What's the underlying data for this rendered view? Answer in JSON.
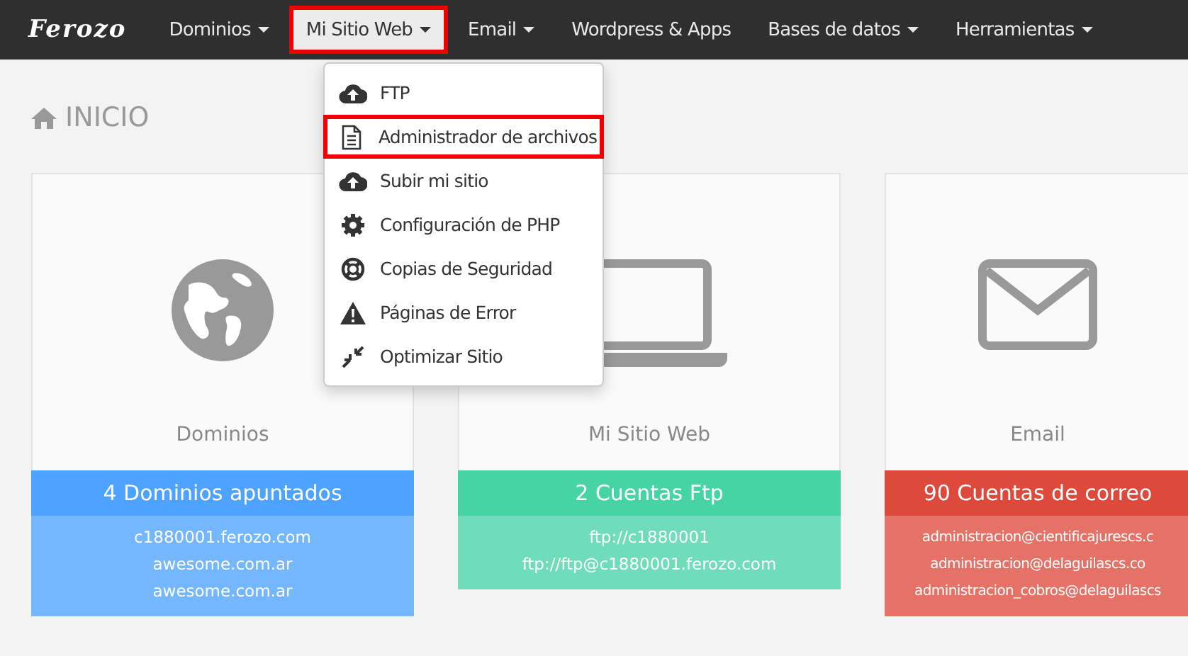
{
  "navbar": {
    "logo": "Ferozo",
    "items": [
      {
        "label": "Dominios",
        "caret": true,
        "selected": false,
        "highlighted": false
      },
      {
        "label": "Mi Sitio Web",
        "caret": true,
        "selected": true,
        "highlighted": true
      },
      {
        "label": "Email",
        "caret": true,
        "selected": false,
        "highlighted": false
      },
      {
        "label": "Wordpress & Apps",
        "caret": false,
        "selected": false,
        "highlighted": false
      },
      {
        "label": "Bases de datos",
        "caret": true,
        "selected": false,
        "highlighted": false
      },
      {
        "label": "Herramientas",
        "caret": true,
        "selected": false,
        "highlighted": false
      }
    ]
  },
  "dropdown": {
    "items": [
      {
        "label": "FTP",
        "kind": "cloud",
        "highlighted": false
      },
      {
        "label": "Administrador de archivos",
        "kind": "file",
        "highlighted": true
      },
      {
        "label": "Subir mi sitio",
        "kind": "cloud",
        "highlighted": false
      },
      {
        "label": "Configuración de PHP",
        "kind": "gear",
        "highlighted": false
      },
      {
        "label": "Copias de Seguridad",
        "kind": "lifebuoy",
        "highlighted": false
      },
      {
        "label": "Páginas de Error",
        "kind": "warning",
        "highlighted": false
      },
      {
        "label": "Optimizar Sitio",
        "kind": "compress",
        "highlighted": false
      }
    ]
  },
  "page": {
    "title": "INICIO"
  },
  "cards": [
    {
      "kind": "globe",
      "label": "Dominios",
      "header": "4 Dominios apuntados",
      "color": "#4da3ff",
      "lines": [
        "c1880001.ferozo.com",
        "awesome.com.ar",
        "awesome.com.ar"
      ]
    },
    {
      "kind": "laptop",
      "label": "Mi Sitio Web",
      "header": "2 Cuentas Ftp",
      "color": "#47d4a5",
      "lines": [
        "ftp://c1880001",
        "ftp://ftp@c1880001.ferozo.com"
      ]
    },
    {
      "kind": "envelope",
      "label": "Email",
      "header": "90 Cuentas de correo",
      "color": "#dd4a3c",
      "lines": [
        "administracion@cientificajurescs.c",
        "administracion@delaguilascs.co",
        "administracion_cobros@delaguilascs"
      ]
    }
  ]
}
